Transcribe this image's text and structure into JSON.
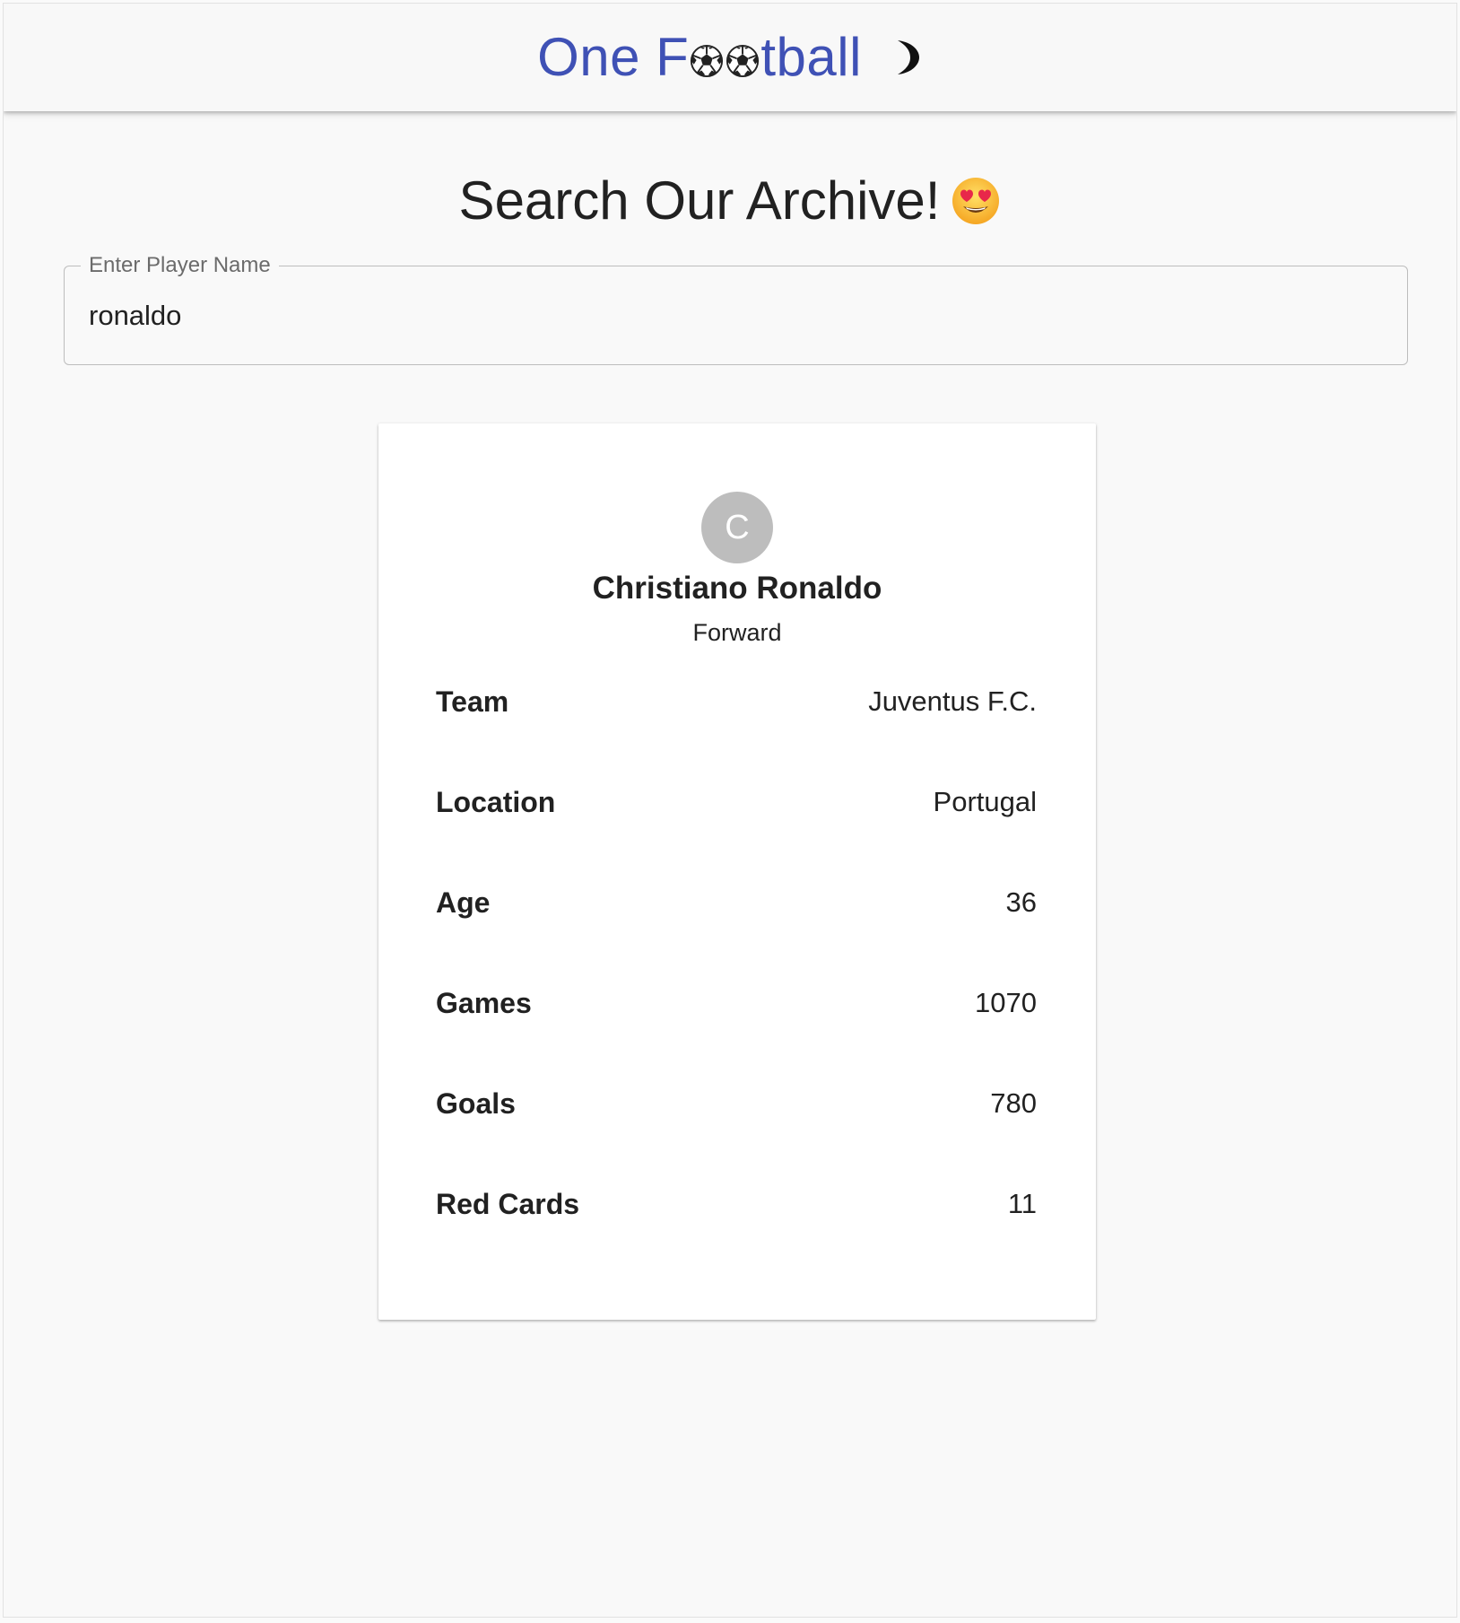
{
  "header": {
    "brand_before": "One F",
    "brand_after": "tball",
    "ball_icon": "soccer-ball-icon",
    "theme_toggle_icon": "moon-icon",
    "theme_toggle_glyph": "☽",
    "brand_color": "#3f51b5"
  },
  "search": {
    "heading": "Search Our Archive!",
    "heading_emoji": "heart-eyes-emoji",
    "label": "Enter Player Name",
    "value": "ronaldo"
  },
  "player": {
    "avatar_letter": "C",
    "name": "Christiano Ronaldo",
    "position": "Forward",
    "stats": [
      {
        "label": "Team",
        "value": "Juventus F.C."
      },
      {
        "label": "Location",
        "value": "Portugal"
      },
      {
        "label": "Age",
        "value": "36"
      },
      {
        "label": "Games",
        "value": "1070"
      },
      {
        "label": "Goals",
        "value": "780"
      },
      {
        "label": "Red Cards",
        "value": "11"
      }
    ]
  }
}
